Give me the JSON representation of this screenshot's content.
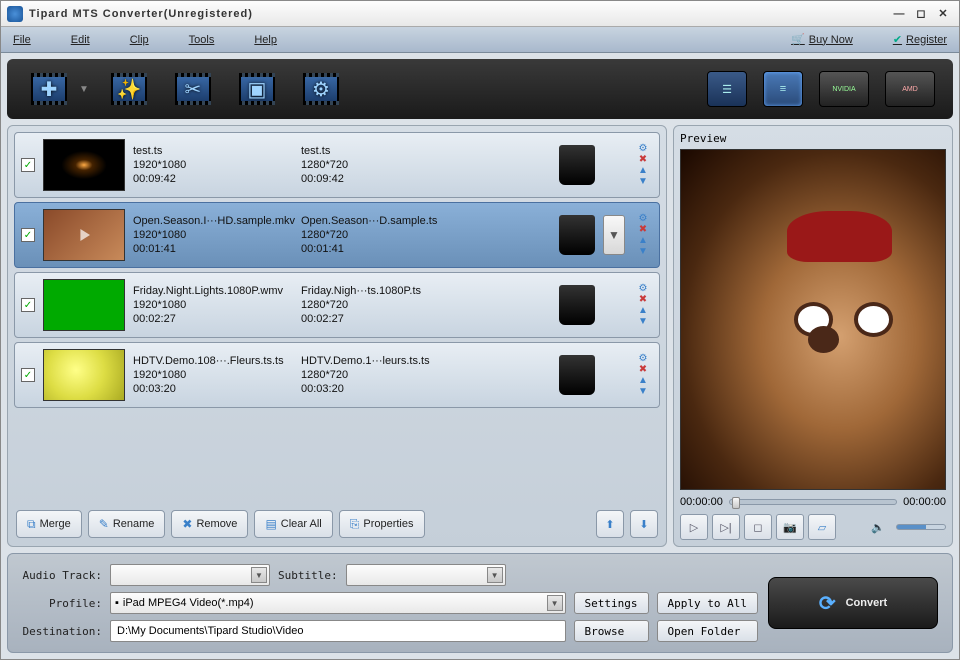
{
  "window": {
    "title": "Tipard MTS Converter(Unregistered)"
  },
  "menu": {
    "file": "File",
    "edit": "Edit",
    "clip": "Clip",
    "tools": "Tools",
    "help": "Help",
    "buy": "Buy Now",
    "register": "Register"
  },
  "files": [
    {
      "checked": "✓",
      "src_name": "test.ts",
      "src_res": "1920*1080",
      "src_dur": "00:09:42",
      "dst_name": "test.ts",
      "dst_res": "1280*720",
      "dst_dur": "00:09:42"
    },
    {
      "checked": "✓",
      "src_name": "Open.Season.I···HD.sample.mkv",
      "src_res": "1920*1080",
      "src_dur": "00:01:41",
      "dst_name": "Open.Season···D.sample.ts",
      "dst_res": "1280*720",
      "dst_dur": "00:01:41"
    },
    {
      "checked": "✓",
      "src_name": "Friday.Night.Lights.1080P.wmv",
      "src_res": "1920*1080",
      "src_dur": "00:02:27",
      "dst_name": "Friday.Nigh···ts.1080P.ts",
      "dst_res": "1280*720",
      "dst_dur": "00:02:27"
    },
    {
      "checked": "✓",
      "src_name": "HDTV.Demo.108···.Fleurs.ts.ts",
      "src_res": "1920*1080",
      "src_dur": "00:03:20",
      "dst_name": "HDTV.Demo.1···leurs.ts.ts",
      "dst_res": "1280*720",
      "dst_dur": "00:03:20"
    }
  ],
  "actions": {
    "merge": "Merge",
    "rename": "Rename",
    "remove": "Remove",
    "clear": "Clear All",
    "props": "Properties"
  },
  "preview": {
    "label": "Preview",
    "t0": "00:00:00",
    "t1": "00:00:00"
  },
  "bottom": {
    "audio_lbl": "Audio Track:",
    "subtitle_lbl": "Subtitle:",
    "profile_lbl": "Profile:",
    "profile_val": "iPad MPEG4 Video(*.mp4)",
    "settings": "Settings",
    "apply": "Apply to All",
    "dest_lbl": "Destination:",
    "dest_val": "D:\\My Documents\\Tipard Studio\\Video",
    "browse": "Browse",
    "open": "Open Folder",
    "convert": "Convert"
  },
  "gpu": {
    "nvidia": "NVIDIA",
    "amd": "AMD"
  }
}
